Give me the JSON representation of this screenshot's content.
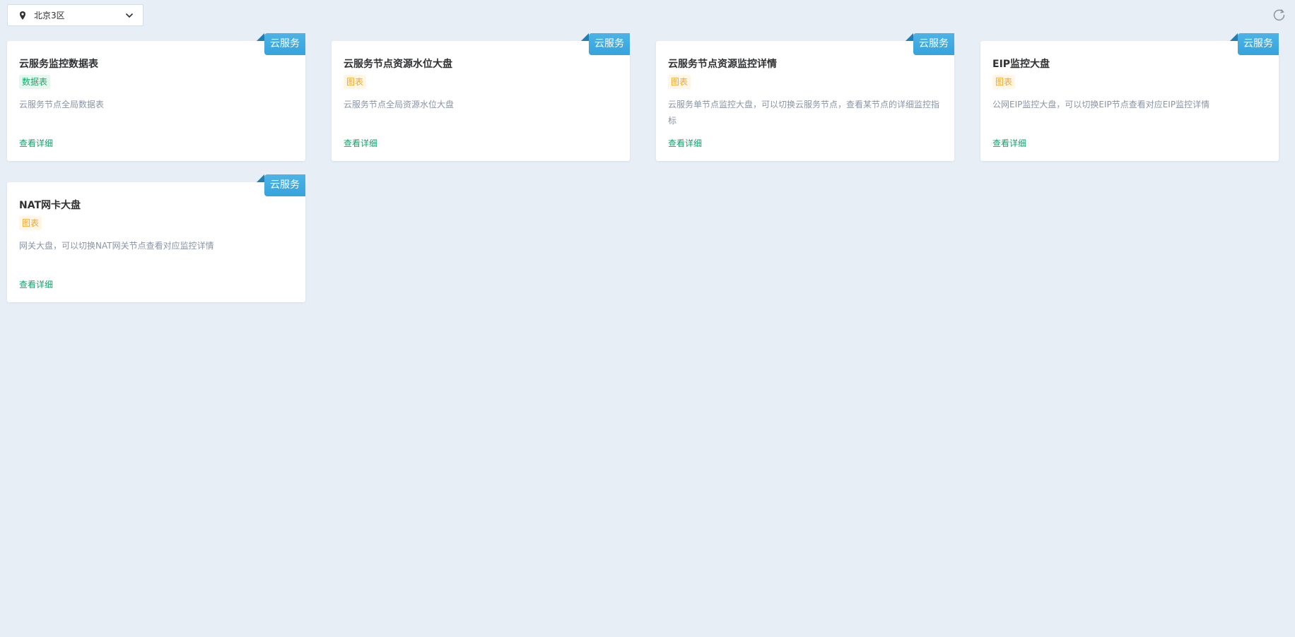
{
  "toolbar": {
    "region": "北京3区",
    "location_icon": "map-pin-icon",
    "dropdown_icon": "chevron-down-icon",
    "refresh_icon": "refresh-icon"
  },
  "colors": {
    "background": "#e8eef6",
    "ribbon": "#3fa9e0",
    "link": "#10a36b",
    "tag_green": "#18a86b",
    "tag_orange": "#f5a623"
  },
  "cards": [
    {
      "title": "云服务监控数据表",
      "tag": "数据表",
      "tag_color": "green",
      "description": "云服务节点全局数据表",
      "link": "查看详细",
      "ribbon": "云服务"
    },
    {
      "title": "云服务节点资源水位大盘",
      "tag": "图表",
      "tag_color": "orange",
      "description": "云服务节点全局资源水位大盘",
      "link": "查看详细",
      "ribbon": "云服务"
    },
    {
      "title": "云服务节点资源监控详情",
      "tag": "图表",
      "tag_color": "orange",
      "description": "云服务单节点监控大盘，可以切换云服务节点，查看某节点的详细监控指标",
      "link": "查看详细",
      "ribbon": "云服务"
    },
    {
      "title": "EIP监控大盘",
      "tag": "图表",
      "tag_color": "orange",
      "description": "公网EIP监控大盘，可以切换EIP节点查看对应EIP监控详情",
      "link": "查看详细",
      "ribbon": "云服务"
    },
    {
      "title": "NAT网卡大盘",
      "tag": "图表",
      "tag_color": "orange",
      "description": "网关大盘，可以切换NAT网关节点查看对应监控详情",
      "link": "查看详细",
      "ribbon": "云服务"
    }
  ]
}
